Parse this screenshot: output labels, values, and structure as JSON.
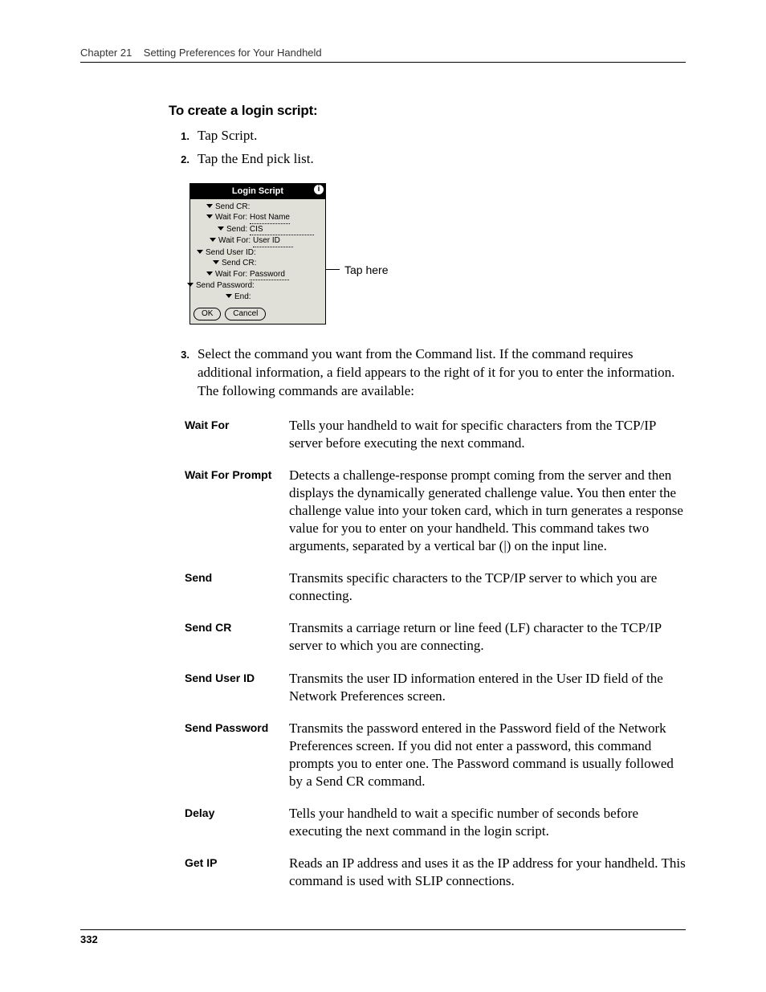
{
  "header": {
    "chapter": "Chapter 21",
    "title": "Setting Preferences for Your Handheld"
  },
  "section_title": "To create a login script:",
  "steps": [
    {
      "num": "1.",
      "text": "Tap Script."
    },
    {
      "num": "2.",
      "text": "Tap the End pick list."
    },
    {
      "num": "3.",
      "text": "Select the command you want from the Command list. If the command requires additional information, a field appears to the right of it for you to enter the information. The following commands are available:"
    }
  ],
  "palm": {
    "title": "Login Script",
    "rows": [
      {
        "indent": 16,
        "label": "Send CR:"
      },
      {
        "indent": 16,
        "label": "Wait For:",
        "value": "Host Name"
      },
      {
        "indent": 30,
        "label": "Send:",
        "value": "CIS"
      },
      {
        "indent": 20,
        "label": "Wait For:",
        "value": "User ID"
      },
      {
        "indent": 4,
        "label": "Send User ID:"
      },
      {
        "indent": 24,
        "label": "Send CR:"
      },
      {
        "indent": 16,
        "label": "Wait For:",
        "value": "Password"
      },
      {
        "indent": 0,
        "label": "Send Password:",
        "no_tri": true
      },
      {
        "indent": 40,
        "label": "End:"
      }
    ],
    "buttons": {
      "ok": "OK",
      "cancel": "Cancel"
    }
  },
  "callout": "Tap here",
  "commands": [
    {
      "term": "Wait For",
      "desc": "Tells your handheld to wait for specific characters from the TCP/IP server before executing the next command."
    },
    {
      "term": "Wait For Prompt",
      "desc": "Detects a challenge-response prompt coming from the server and then displays the dynamically generated challenge value. You then enter the challenge value into your token card, which in turn generates a response value for you to enter on your handheld. This command takes two arguments, separated by a vertical bar (|) on the input line."
    },
    {
      "term": "Send",
      "desc": "Transmits specific characters to the TCP/IP server to which you are connecting."
    },
    {
      "term": "Send CR",
      "desc": "Transmits a carriage return or line feed (LF) character to the TCP/IP server to which you are connecting."
    },
    {
      "term": "Send User ID",
      "desc": "Transmits the user ID information entered in the User ID field of the Network Preferences screen."
    },
    {
      "term": "Send Password",
      "desc": "Transmits the password entered in the Password field of the Network Preferences screen. If you did not enter a password, this command prompts you to enter one. The Password command is usually followed by a Send CR command."
    },
    {
      "term": "Delay",
      "desc": "Tells your handheld to wait a specific number of seconds before executing the next command in the login script."
    },
    {
      "term": "Get IP",
      "desc": "Reads an IP address and uses it as the IP address for your handheld. This command is used with SLIP connections."
    }
  ],
  "page_number": "332"
}
